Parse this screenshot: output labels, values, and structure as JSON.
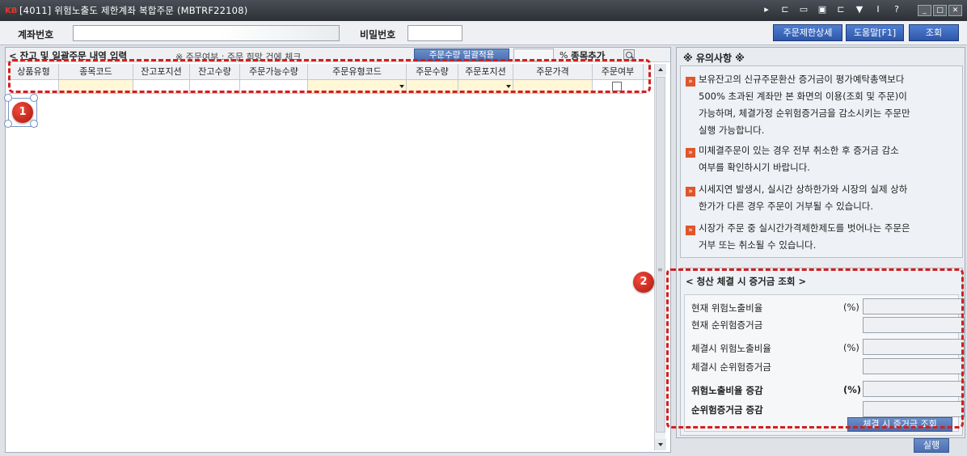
{
  "window": {
    "logo": "KB",
    "title": "[4011] 위험노출도 제한계좌 복합주문 (MBTRF22108)",
    "toolbar_icons": [
      "arrow-right-icon",
      "window-icon",
      "window-icon",
      "settings-icon",
      "window-icon",
      "pin-icon",
      "text-icon",
      "help-icon"
    ],
    "toolbar_glyphs": [
      "▸",
      "⊏",
      "▭",
      "▣",
      "⊏",
      "▼",
      "I",
      "?"
    ]
  },
  "account_bar": {
    "account_label": "계좌번호",
    "account_value": "",
    "password_label": "비밀번호",
    "password_value": "",
    "buttons": {
      "order_limit_detail": "주문제한상세",
      "help": "도움말[F1]",
      "query": "조회"
    }
  },
  "order_section": {
    "title": "< 잔고 및 일괄주문 내역 입력",
    "note": "※ 주문여부 : 주문 희망 건에 체크",
    "apply_button": "주문수량 일괄적용",
    "percent_value": "",
    "percent_label": "%",
    "add_item_label": "종목추가",
    "columns": [
      "상품유형",
      "종목코드",
      "잔고포지션",
      "잔고수량",
      "주문가능수량",
      "주문유형코드",
      "주문수량",
      "주문포지션",
      "주문가격",
      "주문여부"
    ],
    "row": [
      "",
      "",
      "",
      "",
      "",
      "",
      "",
      "",
      "",
      ""
    ]
  },
  "annotations": {
    "badge1": "1",
    "badge2": "2"
  },
  "caution": {
    "title": "※ 유의사항 ※",
    "items": [
      [
        "보유잔고의 신규주문환산 증거금이 평가예탁총액보다",
        "500% 초과된 계좌만 본 화면의 이용(조회 및 주문)이",
        "가능하며, 체결가정 순위험증거금을 감소시키는 주문만",
        "실행 가능합니다."
      ],
      [
        "미체결주문이 있는 경우 전부 취소한 후 증거금 감소",
        "여부를 확인하시기 바랍니다."
      ],
      [
        "시세지연 발생시, 실시간 상하한가와 시장의 실제 상하",
        "한가가 다른 경우 주문이 거부될 수 있습니다."
      ],
      [
        "시장가 주문 중 실시간가격제한제도를 벗어나는 주문은",
        "거부 또는 취소될 수 있습니다."
      ]
    ]
  },
  "settlement": {
    "title": "< 청산 체결 시 증거금 조회 >",
    "rows": [
      {
        "label": "현재 위험노출비율",
        "unit": "(%)",
        "value": ""
      },
      {
        "label": "현재 순위험증거금",
        "unit": "",
        "value": ""
      },
      {
        "label": "체결시 위험노출비율",
        "unit": "(%)",
        "value": ""
      },
      {
        "label": "체결시 순위험증거금",
        "unit": "",
        "value": ""
      },
      {
        "label": "위험노출비율 증감",
        "unit": "(%)",
        "value": ""
      },
      {
        "label": "순위험증거금 증감",
        "unit": "",
        "value": ""
      }
    ],
    "query_button": "체결 시 증거금 조회"
  },
  "execute_button": "실행",
  "colors": {
    "accent_blue": "#2e56a8",
    "highlight_red": "#d21f1f",
    "input_yellow": "#fff7d6",
    "caution_marker": "#e0562b"
  }
}
